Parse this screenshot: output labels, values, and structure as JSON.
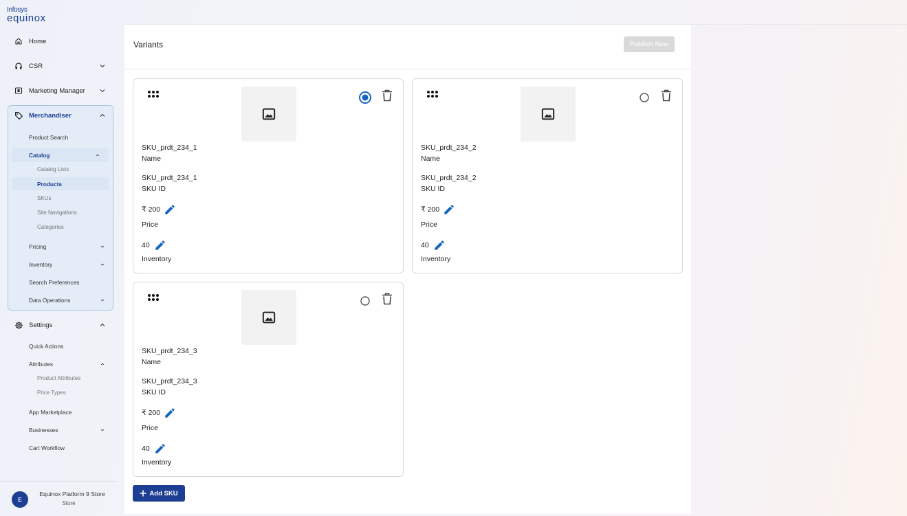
{
  "brand": {
    "top": "Infosys",
    "main": "equinox"
  },
  "sidebar": {
    "home": "Home",
    "csr": "CSR",
    "marketing": "Marketing Manager",
    "merchandiser": "Merchandiser",
    "merch_items": {
      "product_search": "Product Search",
      "catalog": "Catalog",
      "catalog_lists": "Catalog Lists",
      "products": "Products",
      "skus": "SKUs",
      "site_navigations": "Site Navigations",
      "categories": "Categories",
      "pricing": "Pricing",
      "inventory": "Inventory",
      "search_preferences": "Search Preferences",
      "data_operations": "Data Operations"
    },
    "settings": "Settings",
    "settings_items": {
      "quick_actions": "Quick Actions",
      "attributes": "Attributes",
      "product_attributes": "Product Attributes",
      "price_types": "Price Types",
      "app_marketplace": "App Marketplace",
      "businesses": "Businesses",
      "cart_workflow": "Cart Workflow"
    }
  },
  "user": {
    "initial": "E",
    "name": "Equinox Platform 9 Store",
    "role": "Store"
  },
  "main": {
    "title": "Variants",
    "publish_label": "Publish Now",
    "add_sku_label": "Add SKU",
    "labels": {
      "name": "Name",
      "sku_id": "SKU ID",
      "price": "Price",
      "inventory": "Inventory"
    },
    "variants": [
      {
        "name": "SKU_prdt_234_1",
        "sku_id": "SKU_prdt_234_1",
        "price": "₹ 200",
        "inventory": "40",
        "selected": true
      },
      {
        "name": "SKU_prdt_234_2",
        "sku_id": "SKU_prdt_234_2",
        "price": "₹ 200",
        "inventory": "40",
        "selected": false
      },
      {
        "name": "SKU_prdt_234_3",
        "sku_id": "SKU_prdt_234_3",
        "price": "₹ 200",
        "inventory": "40",
        "selected": false
      }
    ]
  },
  "colors": {
    "brand": "#1c3f94",
    "accent": "#1565c0",
    "disabled": "#d9d9d9"
  },
  "icons": [
    "home-icon",
    "headset-icon",
    "megaphone-icon",
    "tag-icon",
    "gear-icon",
    "chevron-down-icon",
    "chevron-up-icon",
    "drag-handle-icon",
    "image-icon",
    "radio-icon",
    "trash-icon",
    "edit-icon",
    "plus-icon"
  ]
}
